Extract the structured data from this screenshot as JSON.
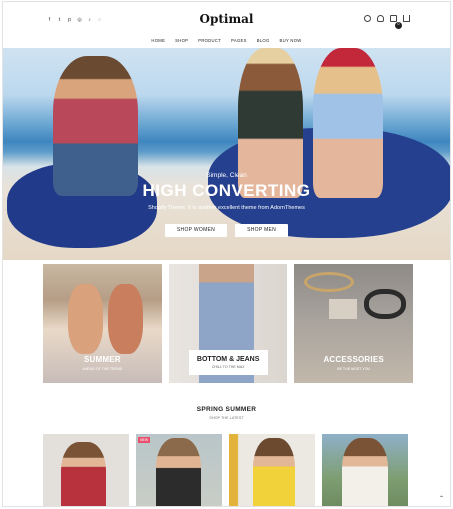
{
  "header": {
    "logo": "Optimal",
    "social_icons": [
      "facebook-icon",
      "twitter-icon",
      "pinterest-icon",
      "instagram-icon",
      "tiktok-icon",
      "snapchat-icon"
    ],
    "social_glyphs": [
      "f",
      "t",
      "p",
      "◎",
      "♪",
      "◌"
    ],
    "cart_count": "0",
    "nav": [
      "HOME",
      "SHOP",
      "PRODUCT",
      "PAGES",
      "BLOG",
      "BUY NOW"
    ]
  },
  "hero": {
    "subtitle": "Simple, Clean",
    "title": "HIGH CONVERTING",
    "description": "Shopify Theme, it is another excellent theme from AdornThemes",
    "btn_women": "SHOP WOMEN",
    "btn_men": "SHOP MEN"
  },
  "categories": [
    {
      "title": "SUMMER",
      "subtitle": "AHEAD OF THE TREND"
    },
    {
      "title": "BOTTOM & JEANS",
      "subtitle": "CHILL TO THE MAX"
    },
    {
      "title": "ACCESSORIES",
      "subtitle": "BE THE MOST YOU"
    }
  ],
  "section": {
    "title": "SPRING SUMMER",
    "subtitle": "SHOP THE LATEST"
  },
  "products": [
    {
      "tag": ""
    },
    {
      "tag": "NEW"
    },
    {
      "tag": ""
    },
    {
      "tag": ""
    }
  ],
  "scroll_top": "⌃",
  "colors": {
    "bag": "#223a8a",
    "hat": "#c2283a",
    "accent": "#e8506e"
  }
}
